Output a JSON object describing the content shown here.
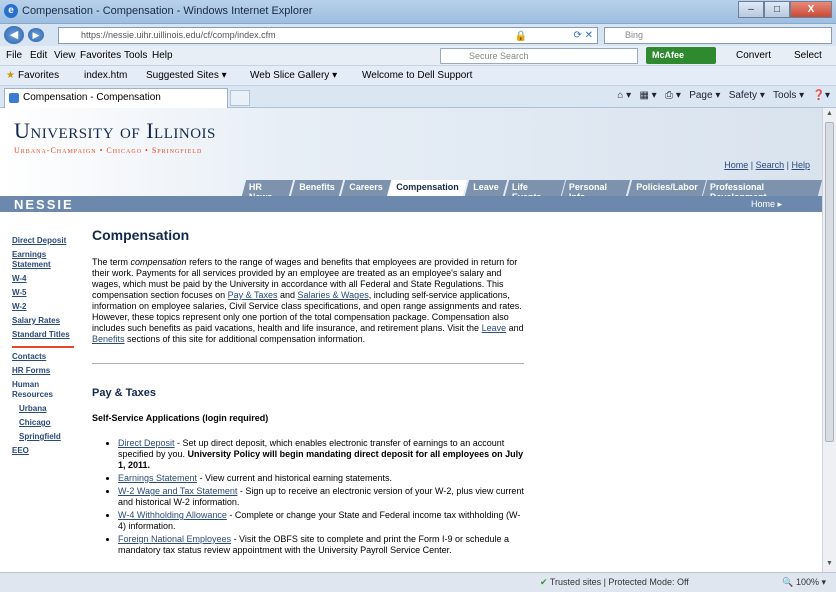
{
  "window": {
    "title": "Compensation - Compensation - Windows Internet Explorer",
    "minimize": "–",
    "restore": "□",
    "close": "X"
  },
  "address": {
    "url": "https://nessie.uihr.uillinois.edu/cf/comp/index.cfm",
    "search_placeholder": "Bing"
  },
  "menu": {
    "items": [
      "File",
      "Edit",
      "View",
      "Favorites",
      "Tools",
      "Help"
    ],
    "secure_search": "Secure Search",
    "mcafee": "McAfee",
    "convert": "Convert",
    "select": "Select"
  },
  "favorites": {
    "label": "Favorites",
    "items": [
      "index.htm",
      "Suggested Sites ▾",
      "Web Slice Gallery ▾",
      "Welcome to Dell Support"
    ]
  },
  "tab": {
    "label": "Compensation - Compensation"
  },
  "commands": {
    "page": "Page ▾",
    "safety": "Safety ▾",
    "tools": "Tools ▾"
  },
  "status": {
    "protected_mode": "Trusted sites | Protected Mode: Off",
    "zoom": "100%"
  },
  "site": {
    "logo_main": "University of Illinois",
    "logo_sub": "Urbana-Champaign • Chicago • Springfield",
    "toplinks": [
      "Home",
      "Search",
      "Help"
    ],
    "nav_tabs": [
      "HR News",
      "Benefits",
      "Careers",
      "Compensation",
      "Leave",
      "Life Events",
      "Personal Info",
      "Policies/Labor",
      "Professional Development"
    ],
    "brand": "NESSIE",
    "home_link": "Home ▸"
  },
  "sidebar": {
    "group1": [
      "Direct Deposit",
      "Earnings Statement",
      "W-4",
      "W-5",
      "W-2",
      "Salary Rates",
      "Standard Titles"
    ],
    "group2": [
      "Contacts",
      "HR Forms",
      "Human Resources"
    ],
    "campuses": [
      "Urbana",
      "Chicago",
      "Springfield"
    ],
    "eeo": "EEO"
  },
  "main": {
    "title": "Compensation",
    "intro_a": "The term ",
    "intro_em": "compensation",
    "intro_b": " refers to the range of wages and benefits that employees are provided in return for their work. Payments for all services provided by an employee are treated as an employee's salary and wages, which must be paid by the University in accordance with all Federal and State Regulations. This compensation section focuses on ",
    "link_pay": "Pay & Taxes",
    "intro_and": " and ",
    "link_sal": "Salaries & Wages",
    "intro_c": ", including self-service applications, information on employee salaries, Civil Service class specifications, and open range assignments and rates. However, these topics represent only one portion of the total compensation package. Compensation also includes such benefits as paid vacations, health and life insurance, and retirement plans. Visit the ",
    "link_leave": "Leave",
    "intro_and2": " and ",
    "link_benefits": "Benefits",
    "intro_d": " sections of this site for additional compensation information.",
    "section_title": "Pay & Taxes",
    "subsection": "Self-Service Applications (login required)",
    "items": [
      {
        "link": "Direct Deposit",
        "text": " - Set up direct deposit, which enables electronic transfer of earnings to an account specified by you. ",
        "bold": "University Policy will begin mandating direct deposit for all employees on July 1, 2011."
      },
      {
        "link": "Earnings Statement",
        "text": " - View current and historical earning statements.",
        "bold": ""
      },
      {
        "link": "W-2 Wage and Tax Statement",
        "text": " - Sign up to receive an electronic version of your W-2, plus view current and historical W-2 information.",
        "bold": ""
      },
      {
        "link": "W-4 Withholding Allowance",
        "text": " - Complete or change your State and Federal income tax withholding (W-4) information.",
        "bold": ""
      },
      {
        "link": "Foreign National Employees",
        "text": " - Visit the OBFS site to complete and print the Form I-9 or schedule a mandatory tax status review appointment with the University Payroll Service Center.",
        "bold": ""
      }
    ]
  }
}
